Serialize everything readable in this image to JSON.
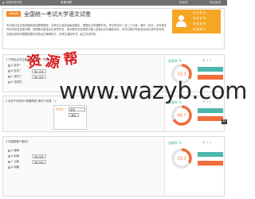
{
  "topbar": {
    "home": "▲ 试卷答卷系统",
    "separator": "»",
    "page": "答卷列表",
    "user": "欢迎您",
    "logout": "退出系统"
  },
  "exam": {
    "badge": "试卷说明",
    "title": "全国统一考试大学语文试卷",
    "description": "本试卷共包含选择题和填空题等题型，请考生认真阅读每道题目，根据自己的理解作答。考试时间为一百二十分钟，满分一百分，请在规定时间内完成全部试题。选择题请直接点击选项作答，填空题请在答案框中输入答案后点击确定保存。考试过程中系统会自动记录作答时间，交卷后系统将根据答题情况给出正确率统计，请考生诚信考试，独立完成作答。"
  },
  "profile": {
    "name": "考 生 姓 名：",
    "id": "准 考 证 号：",
    "time": "考 试 用 时：",
    "score": "本 卷 得 分："
  },
  "questions": [
    {
      "stem": "1 下列加点字注音全部正确的一项是（ ）",
      "options": [
        "A 选项一",
        "B 选项二",
        "C 选项三",
        "D 选项四"
      ],
      "answer_label": "确认答案"
    },
    {
      "stem": "2 补充下列诗句“故国神游”填写下句是（ ）",
      "answer_box": {
        "label": "答案输入：",
        "value": "多情",
        "confirm": "确定"
      }
    },
    {
      "stem": "3 作者是哪个朝代？",
      "options": [
        "A 唐朝",
        "B 宋朝",
        "C 元朝",
        "D 明朝"
      ],
      "answer_label": "确认答案"
    }
  ],
  "stats": [
    {
      "title": "准确率 %",
      "count": "共 3 人",
      "percent": 33.3,
      "label": "33.3",
      "accent": "#f26b3a"
    },
    {
      "title": "准确率 %",
      "count": "共 3 人",
      "percent": 66.7,
      "label": "66.7",
      "accent": "#f26b3a"
    },
    {
      "title": "准确率 %",
      "count": "共 3 人",
      "percent": 33.3,
      "label": "33.3",
      "accent": "#f26b3a"
    }
  ],
  "side_button": "返回",
  "watermark": {
    "cn": [
      "资",
      "源",
      "帮"
    ],
    "url": "www.wazyb.com"
  },
  "colors": {
    "brand_orange": "#f08a24",
    "profile_bg": "#f5a623",
    "teal": "#4db6ac",
    "dial_orange": "#f26b3a"
  }
}
